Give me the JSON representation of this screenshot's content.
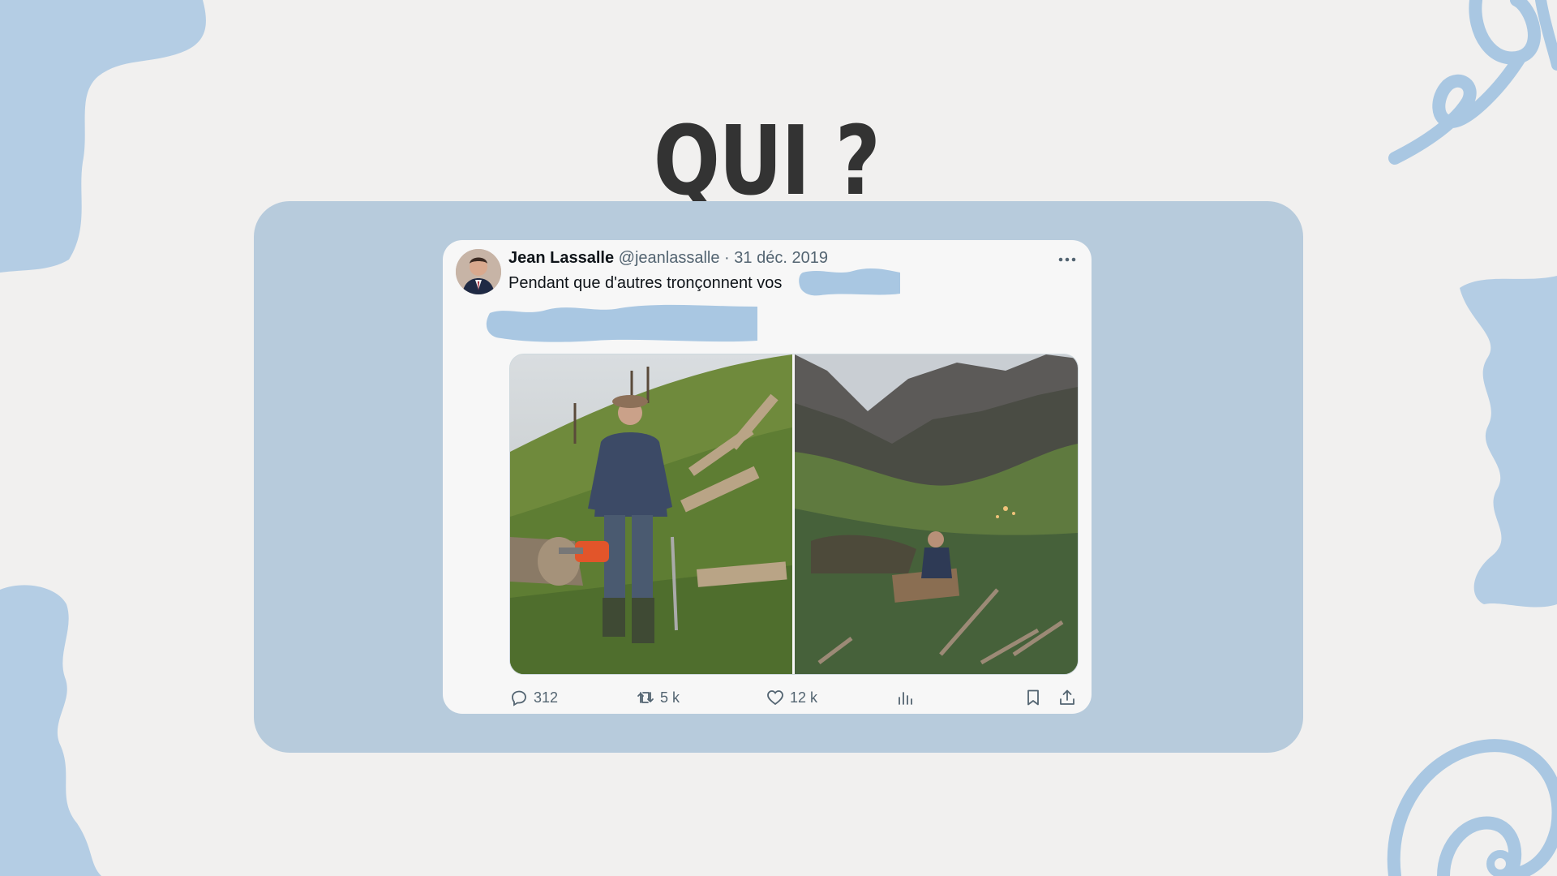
{
  "slide": {
    "title": "QUI ?"
  },
  "tweet": {
    "author_name": "Jean Lassalle",
    "handle": "@jeanlassalle",
    "separator": "·",
    "date": "31 déc. 2019",
    "text": "Pendant que d'autres tronçonnent vos",
    "more_icon": "more-icon",
    "stats": {
      "replies": "312",
      "retweets": "5 k",
      "likes": "12 k"
    },
    "icons": [
      "reply-icon",
      "retweet-icon",
      "like-icon",
      "views-icon",
      "bookmark-icon",
      "share-icon"
    ]
  },
  "colors": {
    "background": "#f1f0ef",
    "panel": "#b7cbdc",
    "card": "#f7f7f7",
    "text_primary": "#0f1419",
    "text_secondary": "#536471",
    "decor_blue": "#9fbfdc"
  }
}
